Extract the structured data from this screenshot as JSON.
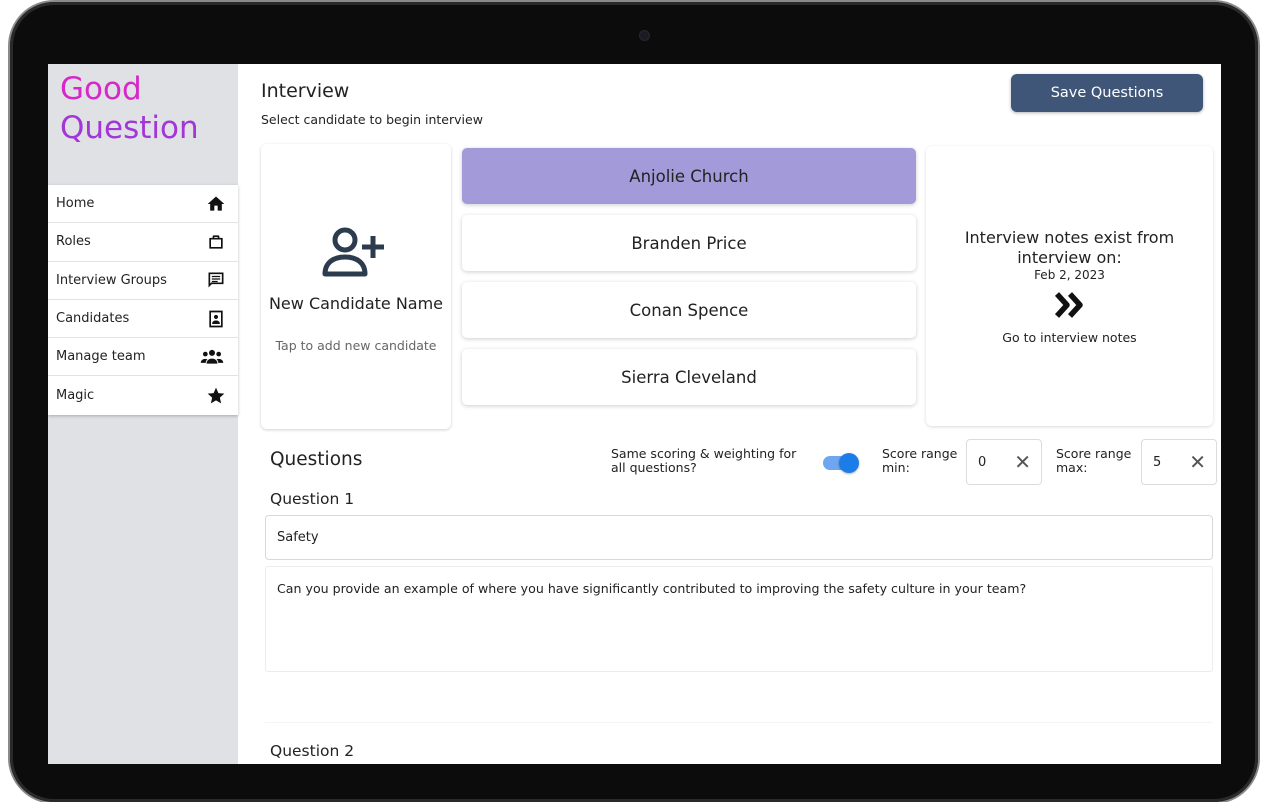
{
  "logo": {
    "line1": "Good",
    "line2": "Question"
  },
  "sidebar": {
    "items": [
      {
        "label": "Home",
        "icon": "home-icon"
      },
      {
        "label": "Roles",
        "icon": "briefcase-icon"
      },
      {
        "label": "Interview Groups",
        "icon": "chat-icon"
      },
      {
        "label": "Candidates",
        "icon": "contact-card-icon"
      },
      {
        "label": "Manage team",
        "icon": "team-icon"
      },
      {
        "label": "Magic",
        "icon": "star-icon"
      }
    ]
  },
  "header": {
    "title": "Interview",
    "subtitle": "Select candidate to begin interview",
    "save_label": "Save Questions"
  },
  "new_candidate": {
    "name": "New Candidate Name",
    "hint": "Tap to add new candidate",
    "icon": "add-user-icon"
  },
  "candidates": [
    {
      "name": "Anjolie Church",
      "selected": true
    },
    {
      "name": "Branden Price",
      "selected": false
    },
    {
      "name": "Conan Spence",
      "selected": false
    },
    {
      "name": "Sierra Cleveland",
      "selected": false
    }
  ],
  "notes": {
    "message": "Interview notes exist from interview on:",
    "date": "Feb 2, 2023",
    "link": "Go to interview notes",
    "icon": "double-chevron-right-icon"
  },
  "questions": {
    "heading": "Questions",
    "same_scoring_label": "Same scoring & weighting for all questions?",
    "same_scoring_enabled": true,
    "score_min_label": "Score range min:",
    "score_min": "0",
    "score_max_label": "Score range max:",
    "score_max": "5",
    "items": [
      {
        "label": "Question 1",
        "title": "Safety",
        "text": "Can you provide an example of where you have significantly contributed to improving the safety culture in your team?"
      },
      {
        "label": "Question 2"
      }
    ]
  },
  "colors": {
    "brand_pink": "#d628c8",
    "brand_purple": "#a236d8",
    "save_button": "#3f5678",
    "selected_candidate": "#a39ad9",
    "toggle": "#1d7de8"
  }
}
